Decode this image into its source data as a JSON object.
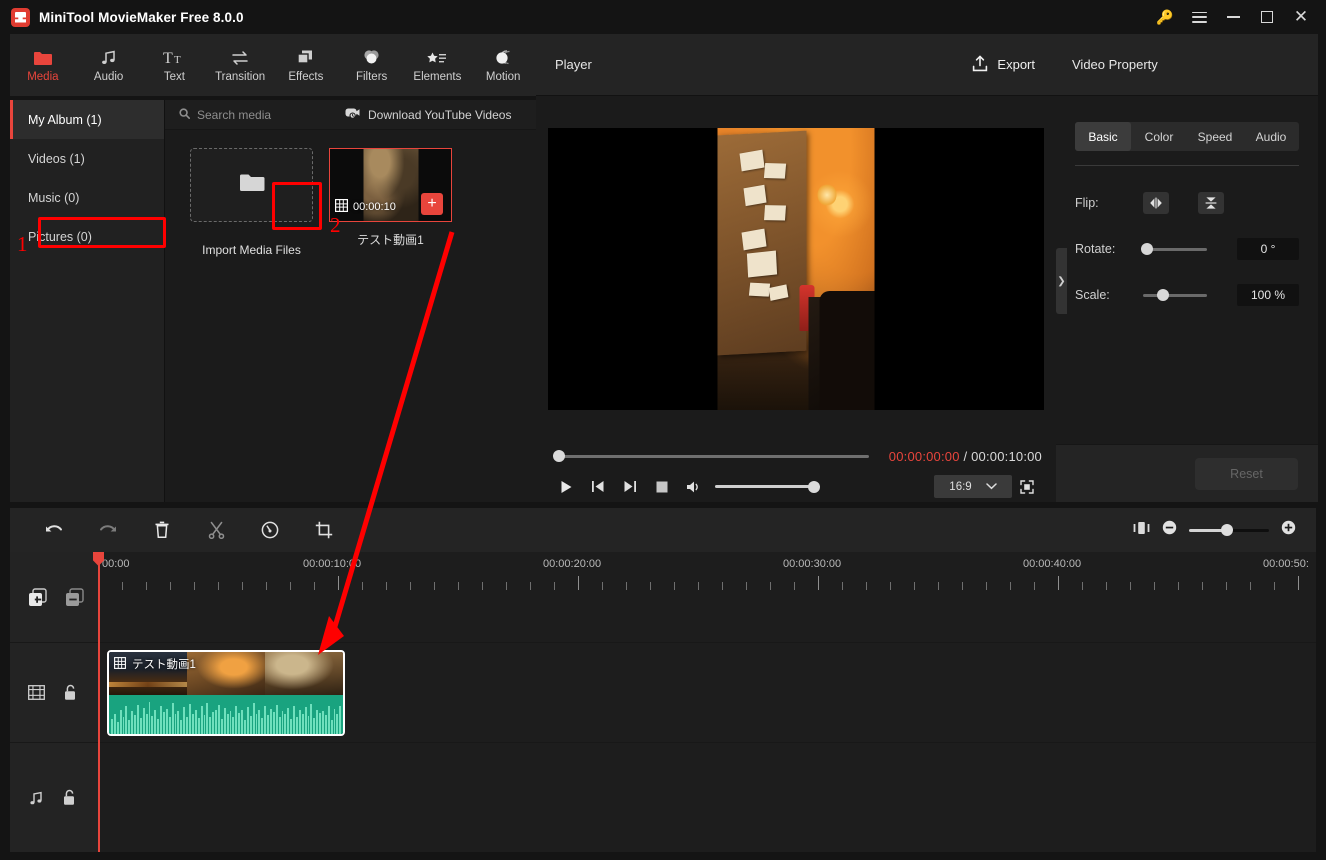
{
  "window": {
    "title": "MiniTool MovieMaker Free 8.0.0",
    "logo_icon": "app-logo-icon",
    "key_icon": "key-icon",
    "menu_icon": "hamburger-menu-icon",
    "minimize_icon": "minimize-icon",
    "maximize_icon": "maximize-icon",
    "close_icon": "close-icon"
  },
  "toolbar": {
    "items": [
      {
        "label": "Media",
        "icon": "folder-icon",
        "active": true
      },
      {
        "label": "Audio",
        "icon": "music-note-icon",
        "active": false
      },
      {
        "label": "Text",
        "icon": "text-icon",
        "active": false
      },
      {
        "label": "Transition",
        "icon": "transition-arrows-icon",
        "active": false
      },
      {
        "label": "Effects",
        "icon": "effects-layers-icon",
        "active": false
      },
      {
        "label": "Filters",
        "icon": "filters-circles-icon",
        "active": false
      },
      {
        "label": "Elements",
        "icon": "elements-star-list-icon",
        "active": false
      },
      {
        "label": "Motion",
        "icon": "motion-sphere-icon",
        "active": false
      }
    ]
  },
  "media_panel": {
    "albums": [
      {
        "label": "My Album (1)",
        "active": true
      },
      {
        "label": "Videos (1)",
        "active": false
      },
      {
        "label": "Music (0)",
        "active": false
      },
      {
        "label": "Pictures (0)",
        "active": false
      }
    ],
    "search_placeholder": "Search media",
    "search_icon": "search-icon",
    "youtube_label": "Download YouTube Videos",
    "youtube_icon": "youtube-download-icon",
    "import_label": "Import Media Files",
    "import_icon": "folder-import-icon",
    "item": {
      "name": "テスト動画1",
      "duration": "00:00:10",
      "film_icon": "film-strip-icon",
      "add_icon": "plus-icon"
    }
  },
  "annotations": [
    {
      "number": "1",
      "target": "import-media-files-button"
    },
    {
      "number": "2",
      "target": "add-to-timeline-button"
    }
  ],
  "player": {
    "title": "Player",
    "export_label": "Export",
    "export_icon": "export-upload-icon",
    "current_time": "00:00:00:00",
    "separator": "/",
    "total_time": "00:00:10:00",
    "play_icon": "play-icon",
    "prev_icon": "previous-frame-icon",
    "next_icon": "next-frame-icon",
    "stop_icon": "stop-icon",
    "volume_icon": "volume-icon",
    "aspect_ratio": "16:9",
    "aspect_caret_icon": "chevron-down-icon",
    "fullscreen_icon": "fullscreen-icon"
  },
  "property": {
    "title": "Video Property",
    "tabs": [
      {
        "label": "Basic",
        "active": true
      },
      {
        "label": "Color",
        "active": false
      },
      {
        "label": "Speed",
        "active": false
      },
      {
        "label": "Audio",
        "active": false
      }
    ],
    "flip_label": "Flip:",
    "flip_h_icon": "flip-horizontal-icon",
    "flip_v_icon": "flip-vertical-icon",
    "rotate_label": "Rotate:",
    "rotate_value": "0 °",
    "scale_label": "Scale:",
    "scale_value": "100 %",
    "reset_label": "Reset",
    "collapse_icon": "chevron-right-icon"
  },
  "timeline": {
    "tools": [
      {
        "icon": "undo-icon",
        "name": "undo-button",
        "dim": false
      },
      {
        "icon": "redo-icon",
        "name": "redo-button",
        "dim": true
      },
      {
        "icon": "delete-trash-icon",
        "name": "delete-button",
        "dim": false
      },
      {
        "icon": "scissors-split-icon",
        "name": "split-button",
        "dim": true
      },
      {
        "icon": "speed-gauge-icon",
        "name": "speed-button",
        "dim": false
      },
      {
        "icon": "crop-icon",
        "name": "crop-button",
        "dim": false
      }
    ],
    "fit_icon": "zoom-to-fit-icon",
    "zoom_out_icon": "zoom-out-icon",
    "zoom_in_icon": "zoom-in-icon",
    "ruler_labels": [
      "00:00",
      "00:00:10:00",
      "00:00:20:00",
      "00:00:30:00",
      "00:00:40:00",
      "00:00:50:"
    ],
    "track_icons": {
      "add_track": "add-track-icon",
      "remove_track": "remove-track-icon",
      "video_track": "film-strip-icon",
      "video_lock": "unlock-icon",
      "audio_track": "music-note-icon",
      "audio_lock": "unlock-icon"
    },
    "clip": {
      "name": "テスト動画1",
      "film_icon": "film-strip-icon"
    }
  }
}
